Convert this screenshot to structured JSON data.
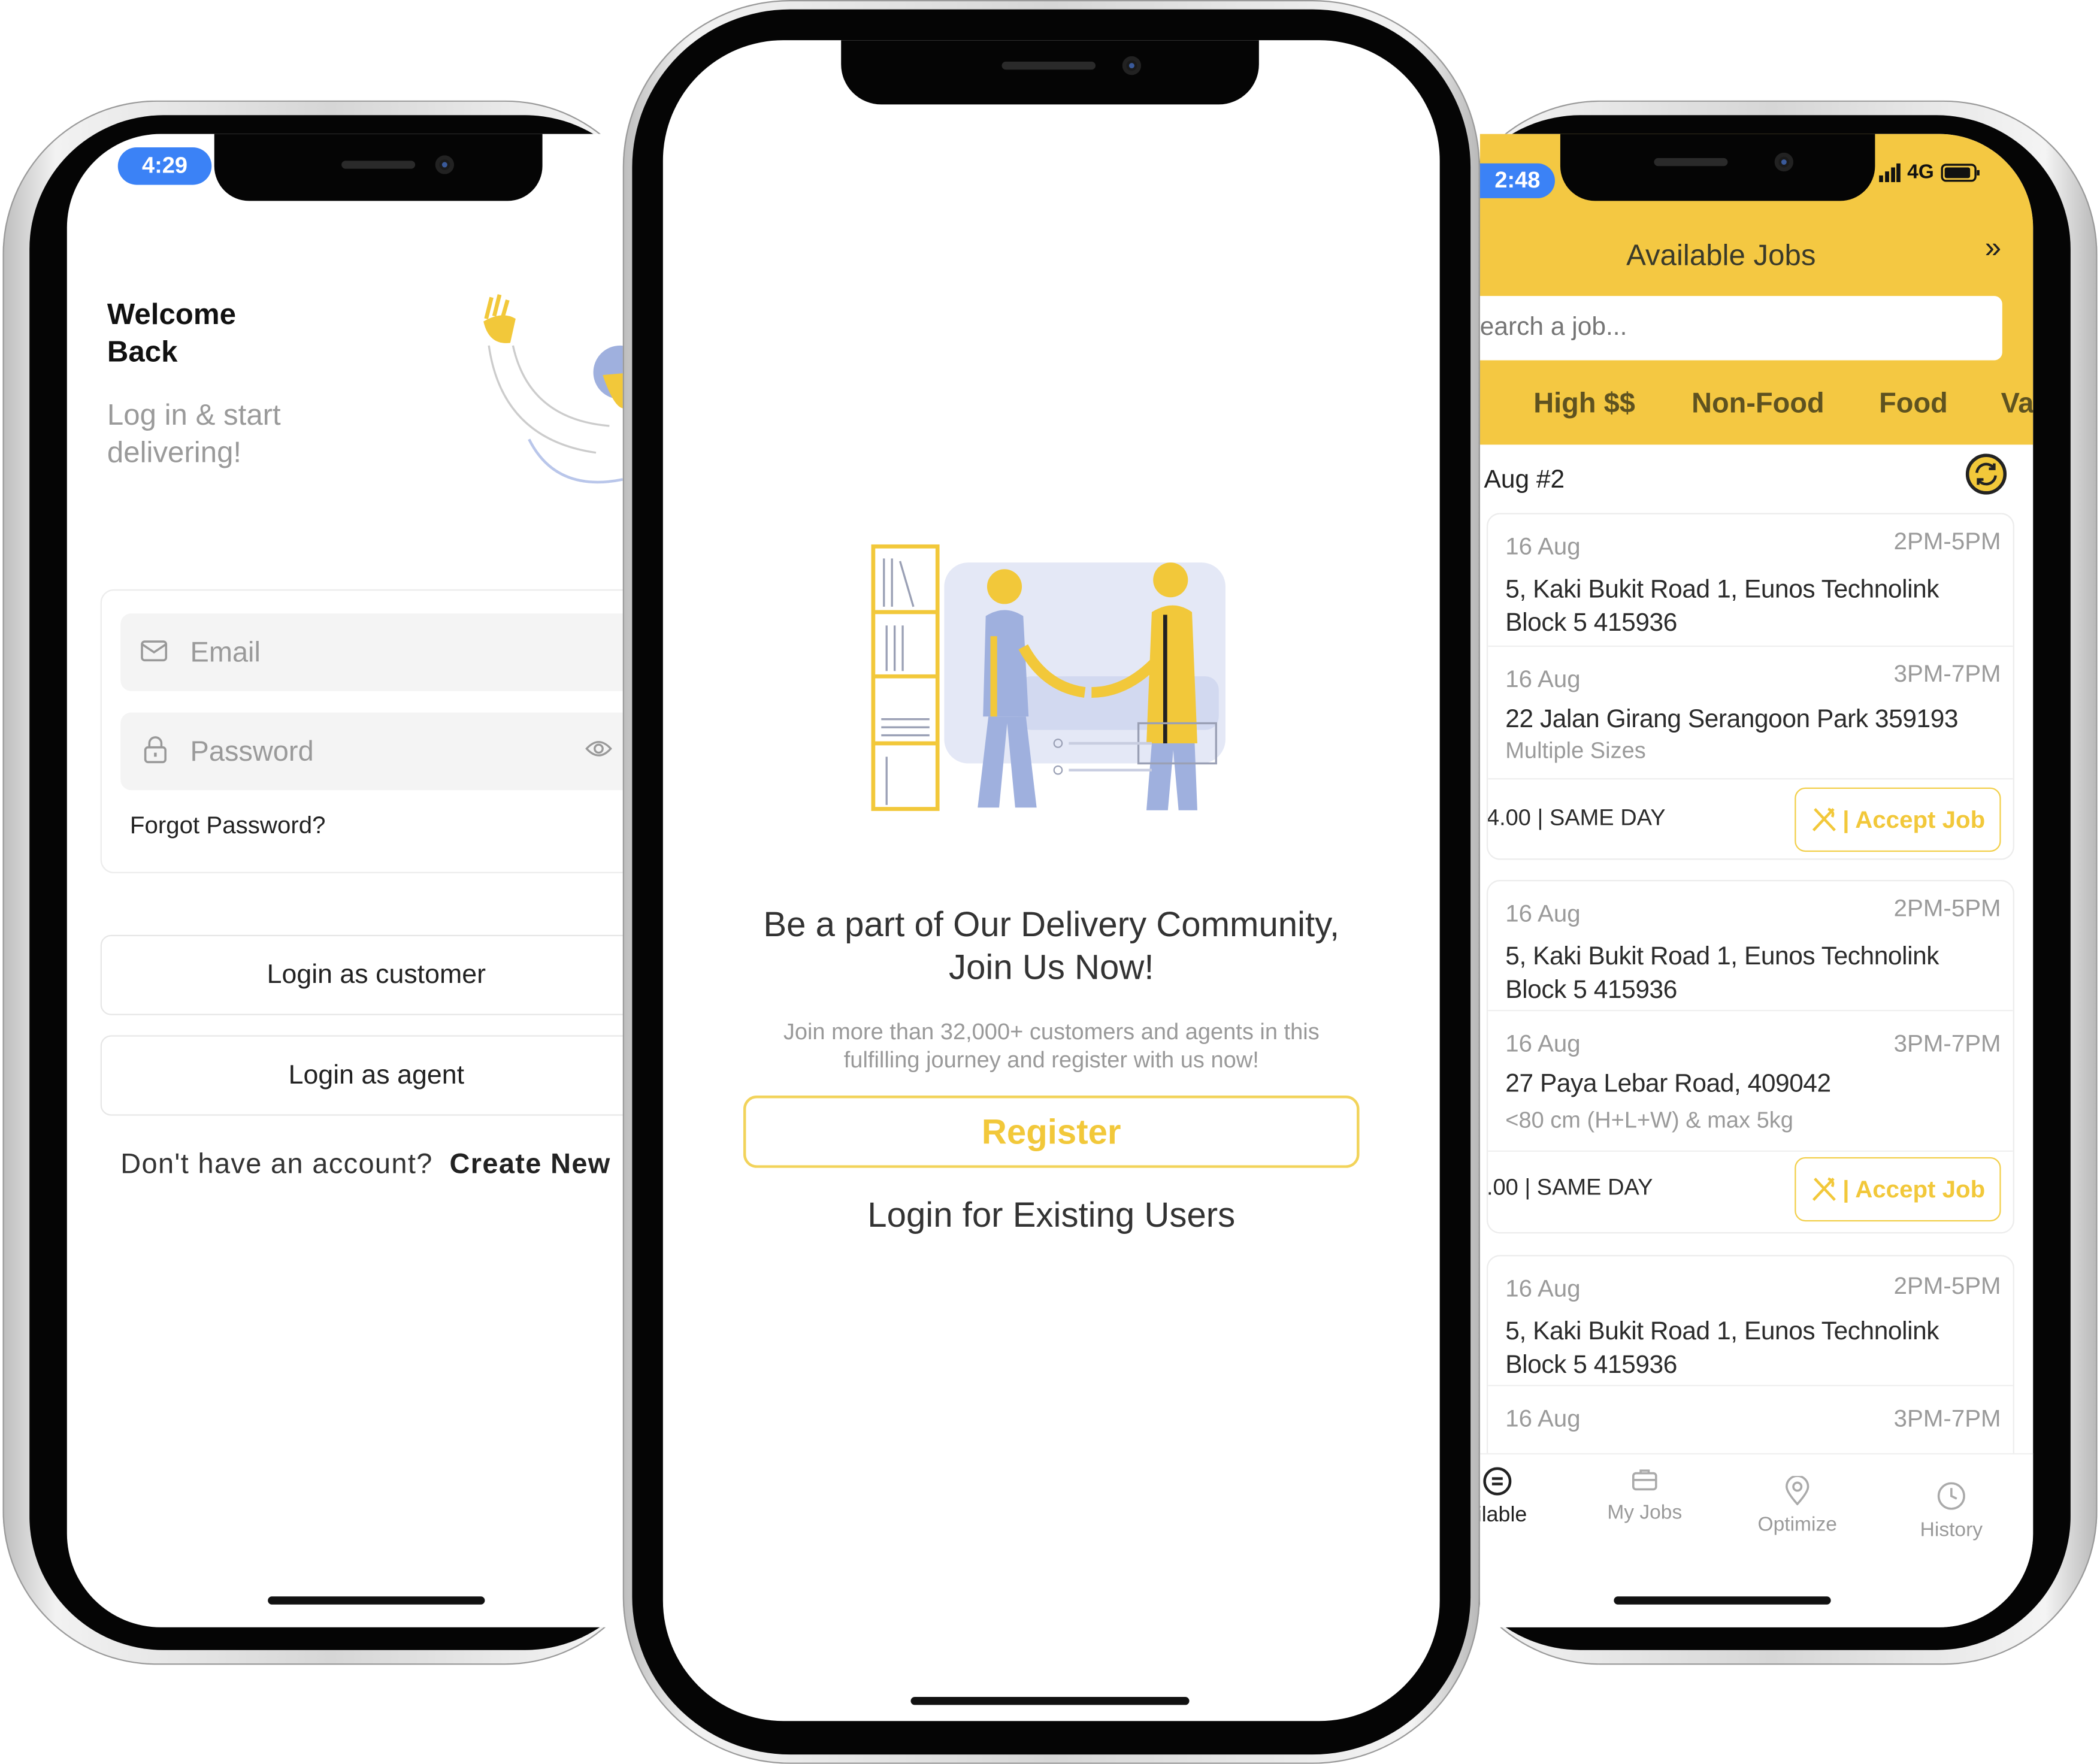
{
  "colors": {
    "accent": "#F4C842",
    "accent_text": "#F2C83A",
    "status_pill": "#3B82F6",
    "tab_text": "#5E5220"
  },
  "login": {
    "status_time": "4:29",
    "title_line1": "Welcome",
    "title_line2": "Back",
    "subtitle_line1": "Log in & start",
    "subtitle_line2": "delivering!",
    "email_placeholder": "Email",
    "password_placeholder": "Password",
    "forgot_password": "Forgot Password?",
    "login_customer": "Login as customer",
    "login_agent": "Login as agent",
    "no_account": "Don't have an account?",
    "create_new": "Create New"
  },
  "welcome": {
    "heading_line1": "Be a part of Our Delivery Community,",
    "heading_line2": "Join Us Now!",
    "description_line1": "Join more than 32,000+ customers and agents in this",
    "description_line2": "fulfilling journey and register with us now!",
    "register": "Register",
    "login_existing": "Login for Existing Users"
  },
  "jobs": {
    "status_time": "2:48",
    "network": "4G",
    "title": "Available Jobs",
    "search_placeholder": "earch a job...",
    "tabs": [
      "High $$",
      "Non-Food",
      "Food",
      "Va"
    ],
    "group_label": "Aug #2",
    "cards": [
      {
        "stops": [
          {
            "date": "16 Aug",
            "time": "2PM-5PM",
            "address": "5, Kaki Bukit Road 1, Eunos Technolink Block 5 415936"
          },
          {
            "date": "16 Aug",
            "time": "3PM-7PM",
            "address": "22 Jalan Girang Serangoon Park 359193",
            "note": "Multiple Sizes"
          }
        ],
        "footer": "4.00 | SAME DAY",
        "accept": "| Accept Job"
      },
      {
        "stops": [
          {
            "date": "16 Aug",
            "time": "2PM-5PM",
            "address": "5, Kaki Bukit Road 1, Eunos Technolink Block 5 415936"
          },
          {
            "date": "16 Aug",
            "time": "3PM-7PM",
            "address": "27 Paya Lebar Road, 409042",
            "note": "<80 cm (H+L+W) & max 5kg"
          }
        ],
        "footer": ".00 | SAME DAY",
        "accept": "| Accept Job"
      },
      {
        "stops": [
          {
            "date": "16 Aug",
            "time": "2PM-5PM",
            "address": "5, Kaki Bukit Road 1, Eunos Technolink Block 5 415936"
          },
          {
            "date": "16 Aug",
            "time": "3PM-7PM"
          }
        ]
      }
    ],
    "nav": [
      "ailable",
      "My Jobs",
      "Optimize",
      "History"
    ]
  }
}
